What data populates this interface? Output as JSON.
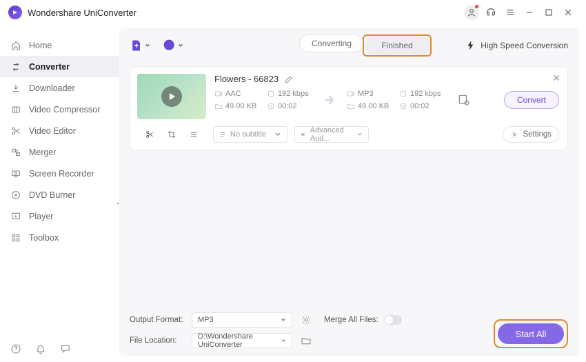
{
  "app": {
    "title": "Wondershare UniConverter"
  },
  "sidebar": {
    "items": [
      {
        "label": "Home"
      },
      {
        "label": "Converter"
      },
      {
        "label": "Downloader"
      },
      {
        "label": "Video Compressor"
      },
      {
        "label": "Video Editor"
      },
      {
        "label": "Merger"
      },
      {
        "label": "Screen Recorder"
      },
      {
        "label": "DVD Burner"
      },
      {
        "label": "Player"
      },
      {
        "label": "Toolbox"
      }
    ]
  },
  "toolbar": {
    "tabs": {
      "converting": "Converting",
      "finished": "Finished"
    },
    "highspeed": "High Speed Conversion"
  },
  "file": {
    "name": "Flowers - 66823",
    "src": {
      "codec": "AAC",
      "bitrate": "192 kbps",
      "size": "49.00 KB",
      "duration": "00:02"
    },
    "dst": {
      "codec": "MP3",
      "bitrate": "192 kbps",
      "size": "49.00 KB",
      "duration": "00:02"
    },
    "convert_label": "Convert",
    "subtitle_label": "No subtitle",
    "audio_label": "Advanced Aud...",
    "settings_label": "Settings"
  },
  "footer": {
    "output_format": {
      "label": "Output Format:",
      "value": "MP3"
    },
    "file_location": {
      "label": "File Location:",
      "value": "D:\\Wondershare UniConverter"
    },
    "merge_label": "Merge All Files:",
    "start_all": "Start All"
  }
}
